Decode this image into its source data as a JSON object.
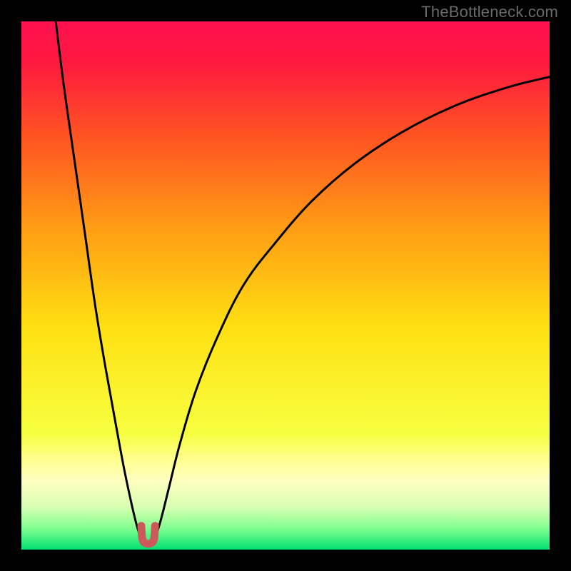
{
  "watermark": "TheBottleneck.com",
  "chart_data": {
    "type": "line",
    "title": "",
    "xlabel": "",
    "ylabel": "",
    "xlim": [
      0,
      100
    ],
    "ylim": [
      0,
      100
    ],
    "gradient_stops": [
      {
        "offset": 0,
        "color": "#ff1050"
      },
      {
        "offset": 0.08,
        "color": "#ff1a3f"
      },
      {
        "offset": 0.22,
        "color": "#ff5522"
      },
      {
        "offset": 0.4,
        "color": "#ffa014"
      },
      {
        "offset": 0.58,
        "color": "#ffe012"
      },
      {
        "offset": 0.78,
        "color": "#f7ff40"
      },
      {
        "offset": 0.83,
        "color": "#ffff90"
      },
      {
        "offset": 0.87,
        "color": "#ffffc0"
      },
      {
        "offset": 0.92,
        "color": "#d8ffb0"
      },
      {
        "offset": 0.96,
        "color": "#80ff90"
      },
      {
        "offset": 1.0,
        "color": "#00e070"
      }
    ],
    "series": [
      {
        "name": "left-branch",
        "stroke": "#000000",
        "width": 3,
        "points": [
          {
            "x": 6.5,
            "y": 100
          },
          {
            "x": 8.0,
            "y": 88
          },
          {
            "x": 10.0,
            "y": 74
          },
          {
            "x": 12.0,
            "y": 60
          },
          {
            "x": 14.0,
            "y": 46
          },
          {
            "x": 16.0,
            "y": 34
          },
          {
            "x": 18.0,
            "y": 23
          },
          {
            "x": 19.5,
            "y": 15
          },
          {
            "x": 21.0,
            "y": 8
          },
          {
            "x": 22.0,
            "y": 4
          },
          {
            "x": 22.7,
            "y": 2.0
          }
        ]
      },
      {
        "name": "right-branch",
        "stroke": "#000000",
        "width": 3,
        "points": [
          {
            "x": 25.3,
            "y": 2.0
          },
          {
            "x": 26.5,
            "y": 6
          },
          {
            "x": 28.0,
            "y": 12
          },
          {
            "x": 30.0,
            "y": 20
          },
          {
            "x": 33.0,
            "y": 30
          },
          {
            "x": 37.0,
            "y": 40
          },
          {
            "x": 42.0,
            "y": 50
          },
          {
            "x": 48.0,
            "y": 58
          },
          {
            "x": 55.0,
            "y": 66
          },
          {
            "x": 63.0,
            "y": 73
          },
          {
            "x": 72.0,
            "y": 79
          },
          {
            "x": 82.0,
            "y": 84
          },
          {
            "x": 92.0,
            "y": 87.5
          },
          {
            "x": 100.0,
            "y": 89.5
          }
        ]
      }
    ],
    "valley_marker": {
      "stroke": "#cc5a5a",
      "width": 11,
      "points": [
        {
          "x": 22.7,
          "y": 4.5
        },
        {
          "x": 22.9,
          "y": 2.0
        },
        {
          "x": 23.5,
          "y": 1.2
        },
        {
          "x": 24.5,
          "y": 1.2
        },
        {
          "x": 25.1,
          "y": 2.0
        },
        {
          "x": 25.3,
          "y": 4.5
        }
      ]
    }
  }
}
